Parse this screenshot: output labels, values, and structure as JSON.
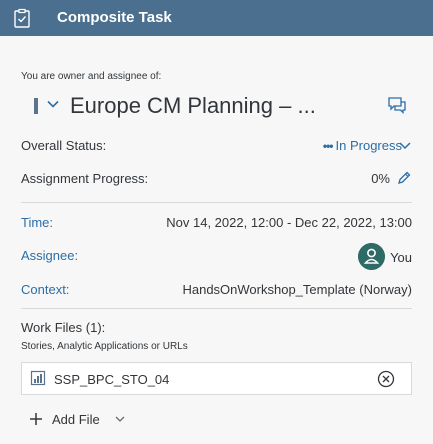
{
  "header": {
    "title": "Composite Task",
    "icon": "clipboard-icon",
    "background": "#4a6f8f"
  },
  "owner_label": "You are owner and assignee of:",
  "plan": {
    "title": "Europe CM Planning – ...",
    "marker_color": "#5b738b"
  },
  "fields": {
    "overall_status": {
      "label": "Overall Status:",
      "value": "In Progress",
      "dots": "•••"
    },
    "assignment_progress": {
      "label": "Assignment Progress:",
      "value": "0%"
    },
    "time": {
      "label": "Time:",
      "value": "Nov 14, 2022, 12:00 - Dec 22, 2022, 13:00"
    },
    "assignee": {
      "label": "Assignee:",
      "value": "You",
      "avatar_color": "#2e6b67"
    },
    "context": {
      "label": "Context:",
      "value": "HandsOnWorkshop_Template (Norway)"
    }
  },
  "work_files": {
    "label": "Work Files (1):",
    "sub_label": "Stories, Analytic Applications or URLs",
    "files": [
      {
        "name": "SSP_BPC_STO_04"
      }
    ],
    "add_label": "Add File"
  },
  "colors": {
    "accent": "#2b6ea8",
    "text": "#32363a"
  }
}
